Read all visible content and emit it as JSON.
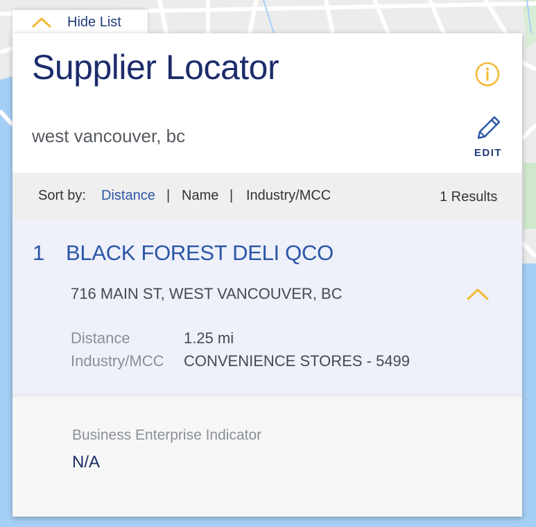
{
  "header": {
    "hide_list_label": "Hide List",
    "title": "Supplier Locator",
    "location_query": "west vancouver, bc",
    "edit_label": "EDIT"
  },
  "sort": {
    "label": "Sort by:",
    "options": [
      "Distance",
      "Name",
      "Industry/MCC"
    ],
    "separator": "|",
    "active": "Distance",
    "results_count": "1 Results"
  },
  "results": [
    {
      "index": "1",
      "name": "BLACK FOREST DELI QCO",
      "address": "716 MAIN ST, WEST VANCOUVER, BC",
      "distance_label": "Distance",
      "distance_value": "1.25 mi",
      "industry_label": "Industry/MCC",
      "industry_value": "CONVENIENCE STORES - 5499",
      "bei_label": "Business Enterprise Indicator",
      "bei_value": "N/A"
    }
  ],
  "colors": {
    "title": "#1c2c6b",
    "link": "#2a55a6",
    "accent_yellow": "#f2b933",
    "water": "#a6cff5",
    "card_bg": "#eef0fa"
  },
  "icons": {
    "hide_list": "chevron-up-icon",
    "info": "info-icon",
    "edit": "pencil-icon",
    "collapse": "chevron-up-icon"
  }
}
